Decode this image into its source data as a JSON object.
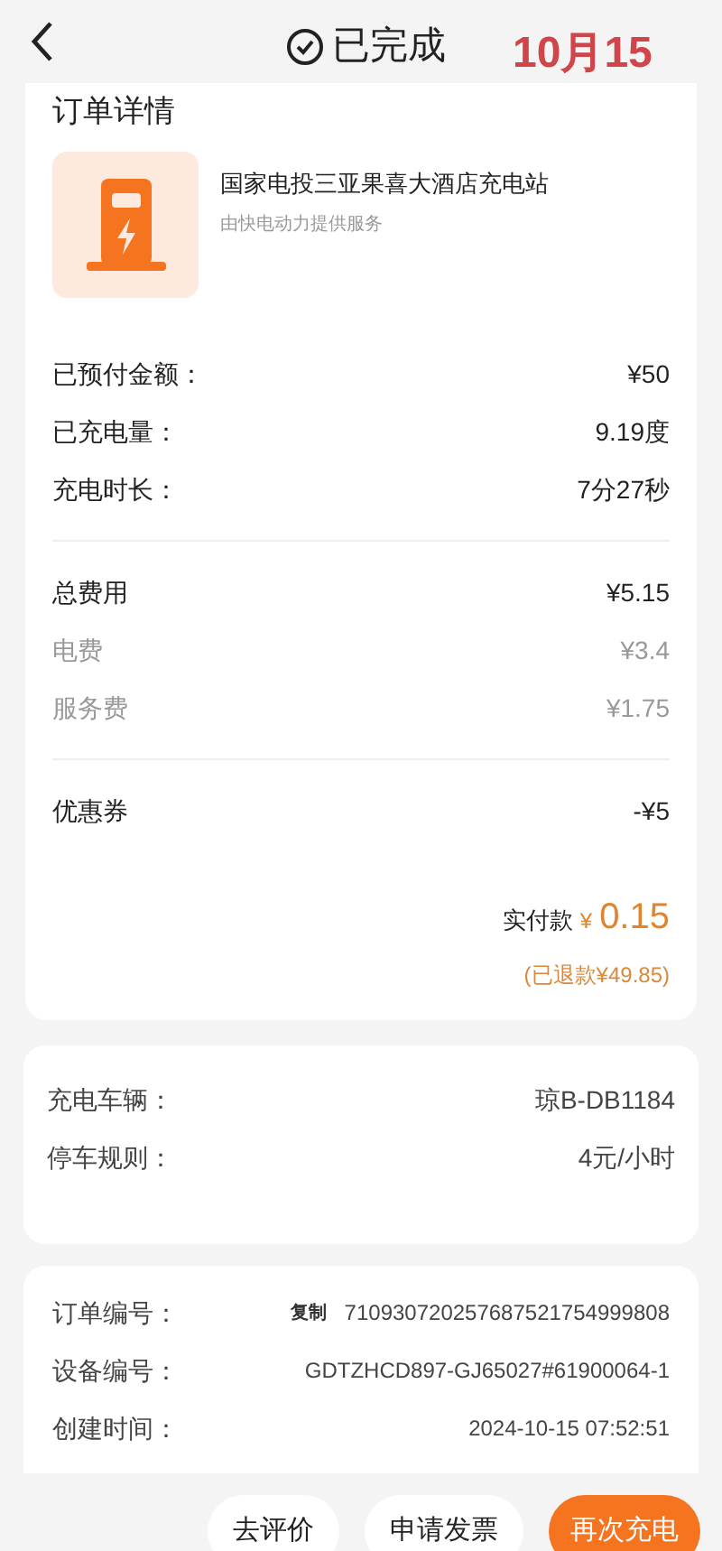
{
  "header": {
    "status": "已完成",
    "annotation": "10月15"
  },
  "order": {
    "title": "订单详情",
    "station": "国家电投三亚果喜大酒店充电站",
    "provider": "由快电动力提供服务",
    "groups": [
      [
        {
          "label": "已预付金额：",
          "value": "¥50",
          "kind": "main"
        },
        {
          "label": "已充电量：",
          "value": "9.19度",
          "kind": "main"
        },
        {
          "label": "充电时长：",
          "value": "7分27秒",
          "kind": "main"
        }
      ],
      [
        {
          "label": "总费用",
          "value": "¥5.15",
          "kind": "main"
        },
        {
          "label": "电费",
          "value": "¥3.4",
          "kind": "sub"
        },
        {
          "label": "服务费",
          "value": "¥1.75",
          "kind": "sub"
        }
      ],
      [
        {
          "label": "优惠券",
          "value": "-¥5",
          "kind": "main"
        }
      ]
    ],
    "paid_label": "实付款",
    "paid_currency": "¥",
    "paid_amount": "0.15",
    "refund": "(已退款¥49.85)"
  },
  "vehicle": [
    {
      "label": "充电车辆：",
      "value": "琼B-DB1184"
    },
    {
      "label": "停车规则：",
      "value": "4元/小时"
    }
  ],
  "info": [
    {
      "label": "订单编号：",
      "value": "710930720257687521754999808",
      "copy": "复制"
    },
    {
      "label": "设备编号：",
      "value": "GDTZHCD897-GJ65027#61900064-1"
    },
    {
      "label": "创建时间：",
      "value": "2024-10-15 07:52:51"
    }
  ],
  "buttons": [
    {
      "label": "去评价",
      "kind": "plain"
    },
    {
      "label": "申请发票",
      "kind": "plain"
    },
    {
      "label": "再次充电",
      "kind": "primary"
    }
  ]
}
